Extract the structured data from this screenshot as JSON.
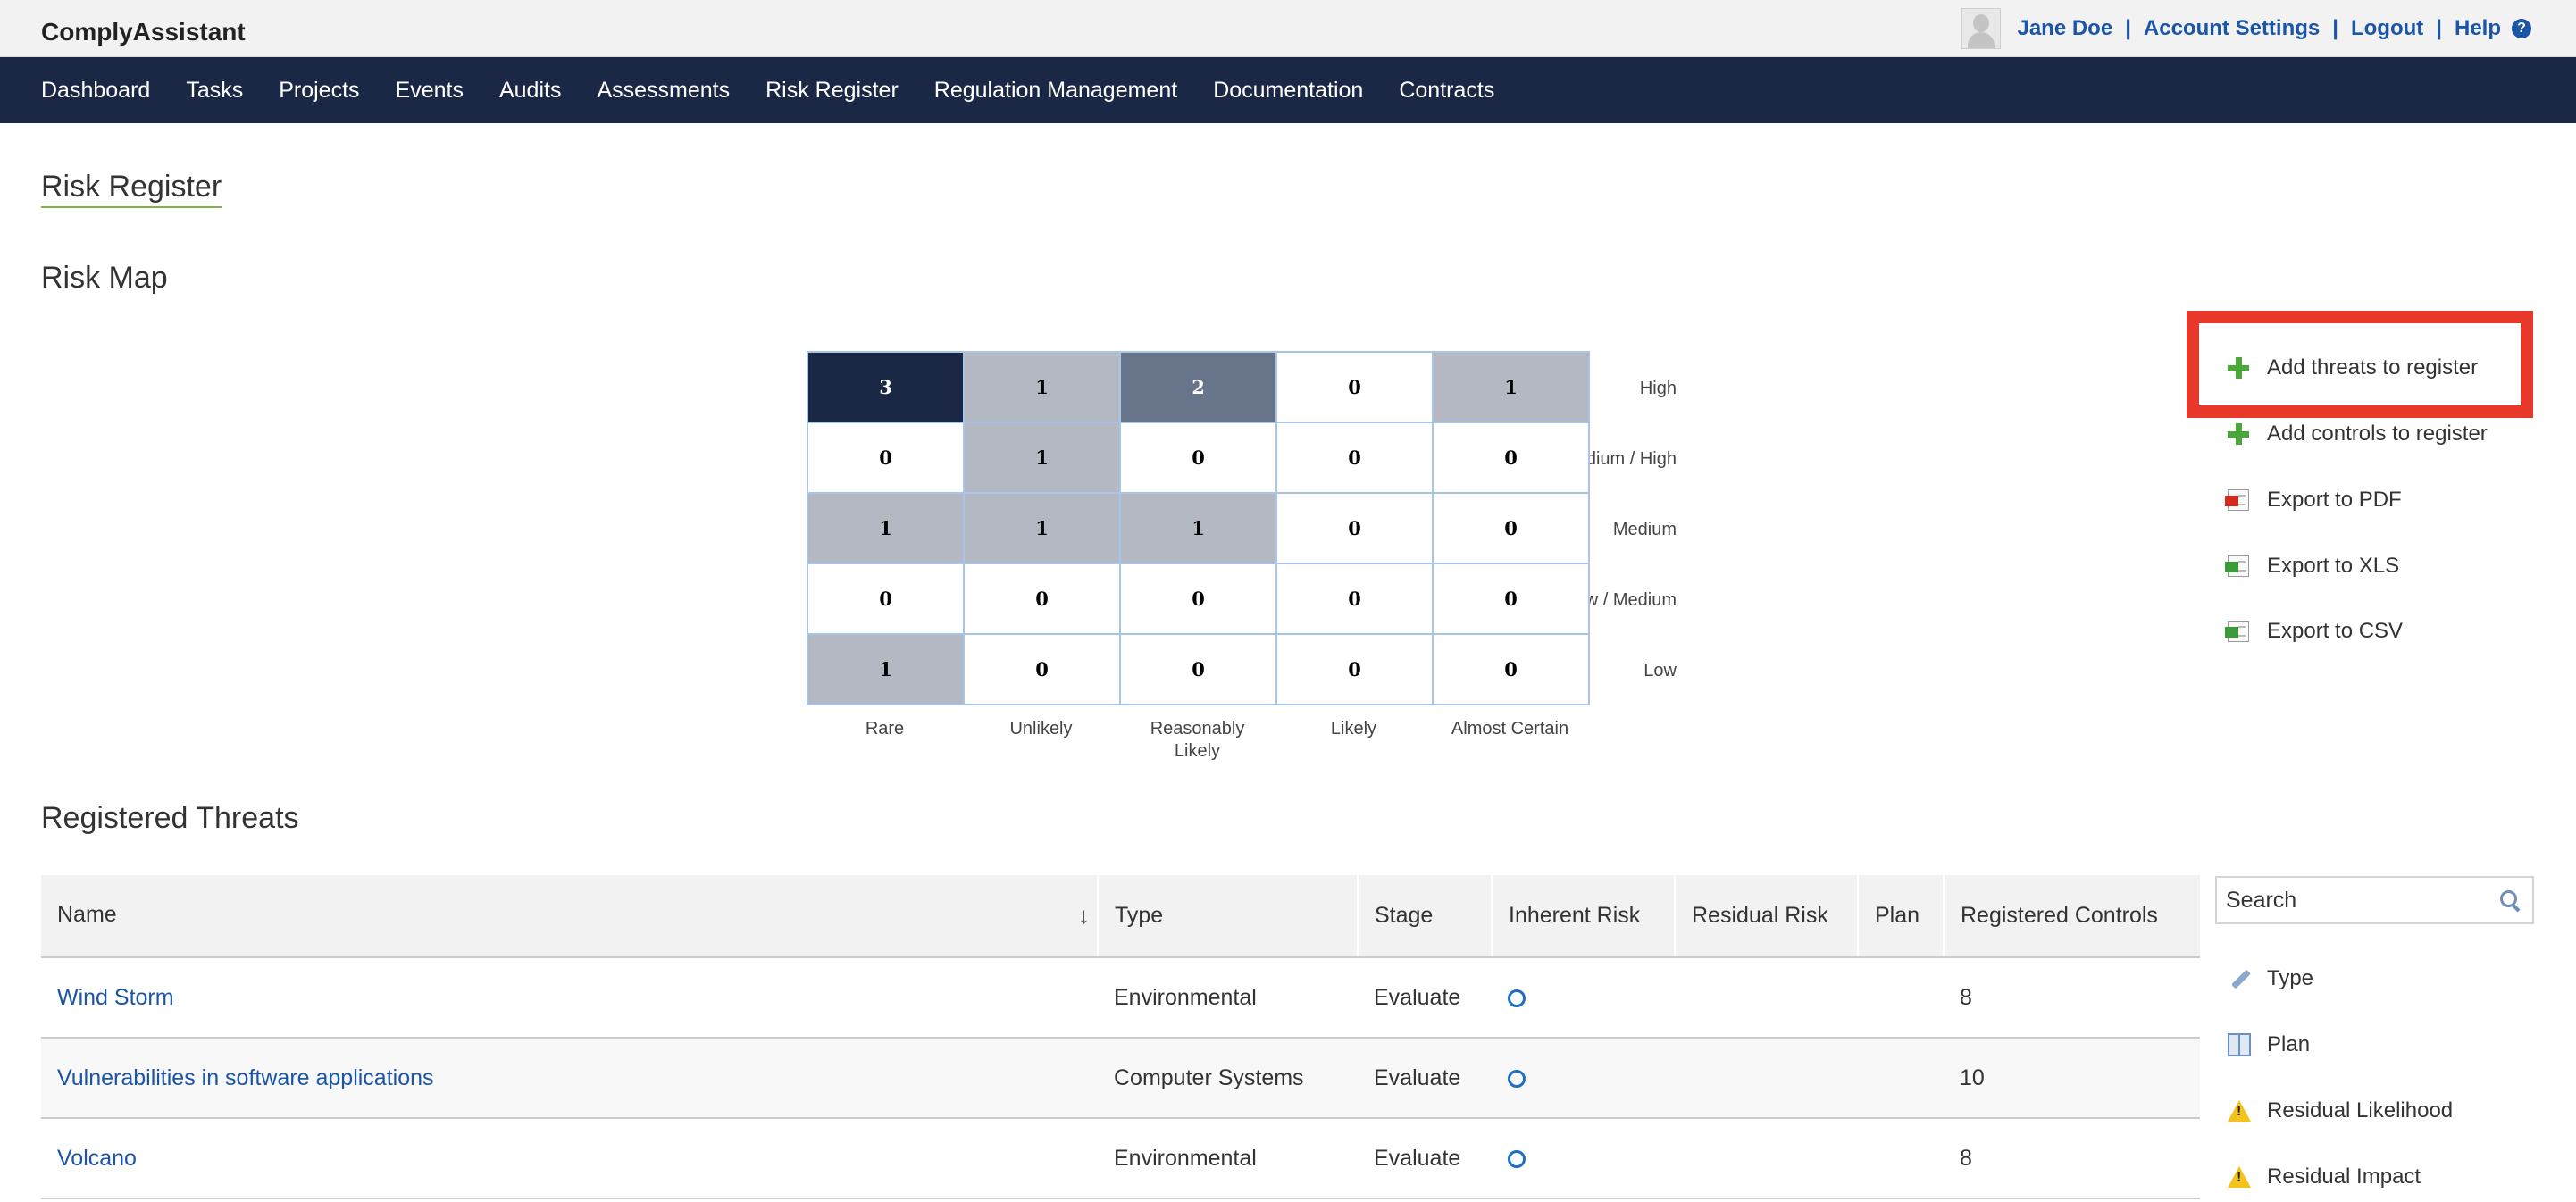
{
  "app": {
    "name": "ComplyAssistant"
  },
  "user": {
    "name": "Jane Doe",
    "links": [
      "Account Settings",
      "Logout",
      "Help"
    ],
    "separator": "|",
    "help_glyph": "?"
  },
  "nav": [
    "Dashboard",
    "Tasks",
    "Projects",
    "Events",
    "Audits",
    "Assessments",
    "Risk Register",
    "Regulation Management",
    "Documentation",
    "Contracts"
  ],
  "page": {
    "title": "Risk Register"
  },
  "risk_map": {
    "title": "Risk Map",
    "impact_levels": [
      "High",
      "Medium / High",
      "Medium",
      "Low / Medium",
      "Low"
    ],
    "likelihood_levels": [
      "Rare",
      "Unlikely",
      "Reasonably Likely",
      "Likely",
      "Almost Certain"
    ],
    "counts": [
      [
        "3",
        "1",
        "2",
        "0",
        "1"
      ],
      [
        "0",
        "1",
        "0",
        "0",
        "0"
      ],
      [
        "1",
        "1",
        "1",
        "0",
        "0"
      ],
      [
        "0",
        "0",
        "0",
        "0",
        "0"
      ],
      [
        "1",
        "0",
        "0",
        "0",
        "0"
      ]
    ],
    "colors": {
      "none": "#ffffff",
      "one": "#b3b8c3",
      "two": "#677489",
      "three": "#1a2745"
    }
  },
  "actions": [
    {
      "label": "Add threats to register",
      "icon": "plus-icon"
    },
    {
      "label": "Add controls to register",
      "icon": "plus-icon"
    },
    {
      "label": "Export to PDF",
      "icon": "pdf-icon"
    },
    {
      "label": "Export to XLS",
      "icon": "xls-icon"
    },
    {
      "label": "Export to CSV",
      "icon": "csv-icon"
    }
  ],
  "threats": {
    "title": "Registered Threats",
    "columns": [
      "Name",
      "Type",
      "Stage",
      "Inherent Risk",
      "Residual Risk",
      "Plan",
      "Registered Controls"
    ],
    "sort_glyph": "↓",
    "rows": [
      {
        "name": "Wind Storm",
        "type": "Environmental",
        "stage": "Evaluate",
        "residual": "",
        "plan": "",
        "controls": "8"
      },
      {
        "name": "Vulnerabilities in software applications",
        "type": "Computer Systems",
        "stage": "Evaluate",
        "residual": "",
        "plan": "",
        "controls": "10"
      },
      {
        "name": "Volcano",
        "type": "Environmental",
        "stage": "Evaluate",
        "residual": "",
        "plan": "",
        "controls": "8"
      }
    ]
  },
  "search": {
    "placeholder": "Search"
  },
  "filters": [
    {
      "label": "Type",
      "icon": "pencil-icon"
    },
    {
      "label": "Plan",
      "icon": "book-icon"
    },
    {
      "label": "Residual Likelihood",
      "icon": "warning-icon"
    },
    {
      "label": "Residual Impact",
      "icon": "warning-icon"
    }
  ],
  "accent": {
    "nav_bg": "#1a2745",
    "link": "#1b55a8",
    "highlight": "#e8382a"
  }
}
